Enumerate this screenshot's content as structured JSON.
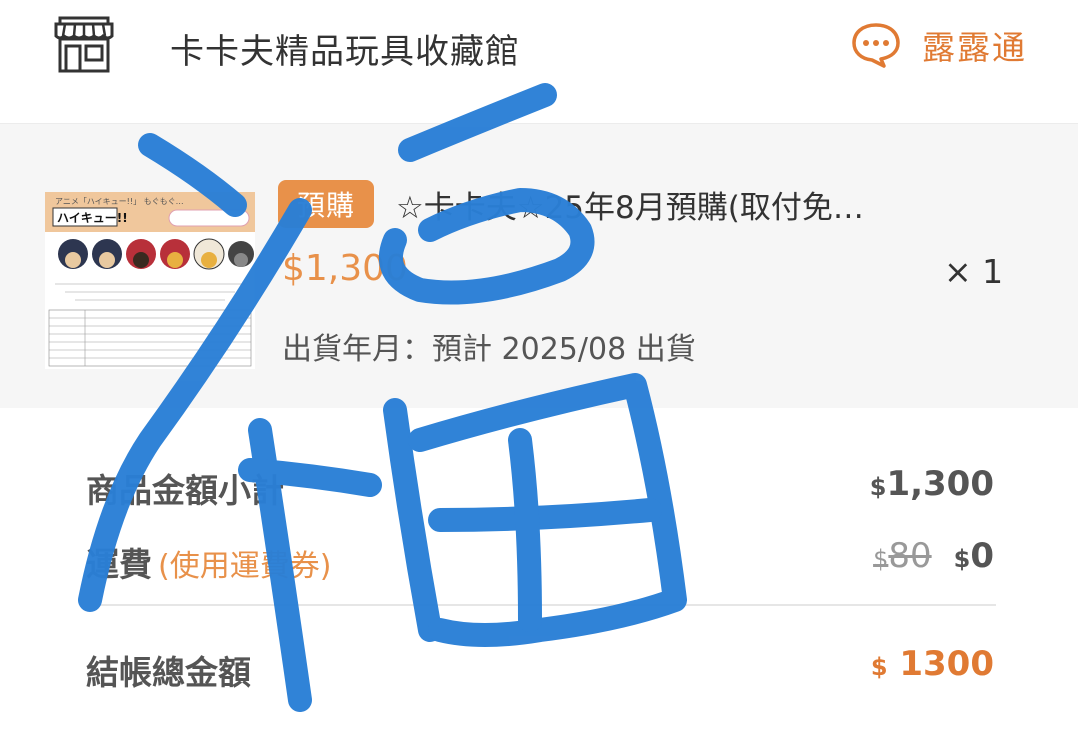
{
  "header": {
    "shop_name": "卡卡夫精品玩具收藏館",
    "chat_label": "露露通",
    "shop_icon": "storefront-icon",
    "chat_icon": "chat-bubble-icon"
  },
  "product": {
    "badge": "預購",
    "title": "☆卡卡夫☆25年8月預購(取付免…",
    "price": "$1,300",
    "quantity": "× 1",
    "ship_note": "出貨年月：預計 2025/08 出貨",
    "thumbnail": {
      "logo_text": "ハイキュー!!",
      "caption": "アニメ「ハイキュー!!」 もぐもぐ…"
    }
  },
  "summary": {
    "subtotal_label": "商品金額小計",
    "subtotal_currency": "$",
    "subtotal_value": "1,300",
    "shipping_label": "運費",
    "shipping_coupon": "(使用運費券)",
    "shipping_original_currency": "$",
    "shipping_original": "80",
    "shipping_currency": "$",
    "shipping_value": "0",
    "total_label": "結帳總金額",
    "total_currency": "$",
    "total_value": "1300"
  },
  "colors": {
    "accent": "#e8914a",
    "accent_dark": "#e07a33",
    "scribble": "#2a7fd6",
    "text": "#333333"
  },
  "overlay": {
    "handwritten_character": "福"
  }
}
